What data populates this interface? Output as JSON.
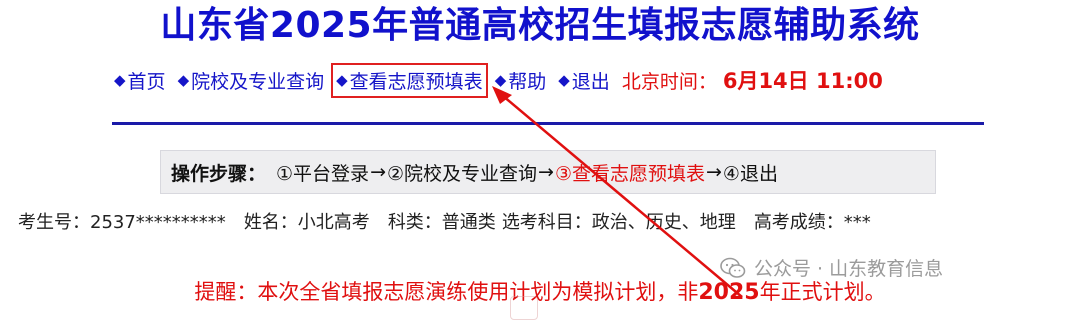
{
  "header": {
    "title": "山东省2025年普通高校招生填报志愿辅助系统"
  },
  "nav": {
    "items": [
      {
        "label": "首页"
      },
      {
        "label": "院校及专业查询"
      },
      {
        "label": "查看志愿预填表"
      },
      {
        "label": "帮助"
      },
      {
        "label": "退出"
      }
    ],
    "diamond": "◆",
    "time_label": "北京时间：",
    "time_value": "6月14日 11:00"
  },
  "steps": {
    "label": "操作步骤：",
    "items": [
      "①平台登录",
      "②院校及专业查询",
      "③查看志愿预填表",
      "④退出"
    ],
    "arrow": "→"
  },
  "info": {
    "exam_no": "考生号：2537**********",
    "name": "姓名：小北高考",
    "category": "科类：普通类",
    "subjects": "选考科目：政治、历史、地理",
    "score": "高考成绩：***"
  },
  "warning": {
    "prefix": "提醒：本次全省填报志愿演练使用计划为模拟计划，非",
    "year": "2025",
    "suffix": "年正式计划。"
  },
  "watermark": {
    "icon": "wechat-icon",
    "text": "公众号 · 山东教育信息"
  },
  "colors": {
    "title_blue": "#1111cc",
    "nav_blue": "#1515c8",
    "alert_red": "#e01010",
    "divider": "#1a1aa8",
    "steps_bg": "#eeeef0"
  }
}
